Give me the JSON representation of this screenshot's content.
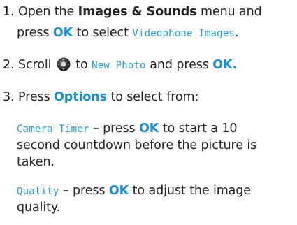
{
  "steps": [
    {
      "number": "1.",
      "text_a": "Open the",
      "menu": "Images & Sounds",
      "text_b": "menu and",
      "text_c": "press",
      "ok": "OK",
      "text_d": "to select",
      "screen_item": "Videophone Images",
      "end": "."
    },
    {
      "number": "2.",
      "text_a": "Scroll",
      "text_b": "to",
      "screen_item": "New Photo",
      "text_c": "and press",
      "ok": "OK."
    },
    {
      "number": "3.",
      "text_a": "Press",
      "options": "Options",
      "text_b": "to select from:"
    }
  ],
  "options": [
    {
      "screen_item": "Camera Timer",
      "dash": "– press",
      "ok": "OK",
      "text_a": "to start a 10",
      "text_b": "second countdown before the picture is",
      "text_c": "taken."
    },
    {
      "screen_item": "Quality",
      "dash": "– press",
      "ok": "OK",
      "text_a": "to adjust the image",
      "text_b": "quality."
    }
  ],
  "icons": {
    "nav_key": "navigation-key-icon"
  },
  "colors": {
    "accent_blue": "#1f8fc8",
    "screen_text_blue": "#2a9ad0",
    "body_text": "#222222"
  }
}
